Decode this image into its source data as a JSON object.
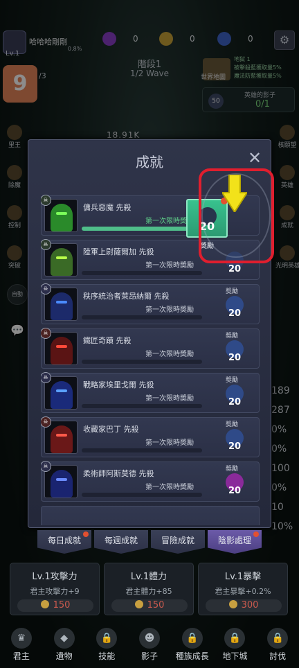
{
  "player": {
    "level": "Lv.1",
    "name": "哈哈哈剛剛",
    "exp": "0.8%"
  },
  "resources": [
    {
      "name": "purple-gem",
      "value": "0",
      "color": "#8a3fc8"
    },
    {
      "name": "gold-coin",
      "value": "0",
      "color": "#c9a238"
    },
    {
      "name": "blue-crystal",
      "value": "0",
      "color": "#3e64c8"
    }
  ],
  "stage": {
    "label": "階段1",
    "wave": "1/2 Wave",
    "wave_count": "/3"
  },
  "badge": "9",
  "world_map": {
    "label": "世界地圖",
    "effects": [
      "地獄 1",
      "被擊殺藍獲取量5%",
      "魔法防藍獲取量5%"
    ]
  },
  "shadow": {
    "title": "英雄的影子",
    "value": "0/1",
    "count": "50"
  },
  "dps": "18.91K",
  "left_side": [
    "里王",
    "除魔",
    "控制",
    "突破"
  ],
  "right_side": [
    "核願望",
    "英雄",
    "成就",
    "光明英雄"
  ],
  "auto_label": "自動",
  "right_stats": [
    "189",
    "287",
    "0%",
    "0%",
    "100",
    "0%",
    "10",
    "10%"
  ],
  "modal": {
    "title": "成就",
    "close": "✕",
    "highlight": {
      "label": "獎勵",
      "value": "20"
    },
    "rows": [
      {
        "name": "傭兵惡魔 先殺",
        "limited": "第一次限時獎勵",
        "reward_label": "",
        "reward": "20",
        "progress": 1.0,
        "fig": "#2a8a2a",
        "eye": "#7cff5a",
        "gem": "#2f3f68"
      },
      {
        "name": "陸軍上尉薩爾加 先殺",
        "limited": "第一次限時獎勵",
        "reward_label": "",
        "reward": "20",
        "progress": 0,
        "fig": "#3a6a26",
        "eye": "#b8ff4a",
        "gem": "#2f3f68"
      },
      {
        "name": "秩序統治者萊昂納爾 先殺",
        "limited": "第一次限時獎勵",
        "reward_label": "獎勵",
        "reward": "20",
        "progress": 0,
        "fig": "#1c2a6a",
        "eye": "#4a8aff",
        "gem": "#2f4a88"
      },
      {
        "name": "鐵匠奇蹟 先殺",
        "limited": "第一次限時獎勵",
        "reward_label": "獎勵",
        "reward": "20",
        "progress": 0,
        "fig": "#5a1414",
        "eye": "#ff4a3a",
        "gem": "#2f4a88"
      },
      {
        "name": "戰略家埃里戈爾 先殺",
        "limited": "第一次限時獎勵",
        "reward_label": "獎勵",
        "reward": "20",
        "progress": 0,
        "fig": "#1a2a7a",
        "eye": "#5aa0ff",
        "gem": "#2f4a88"
      },
      {
        "name": "收藏家巴丁 先殺",
        "limited": "第一次限時獎勵",
        "reward_label": "獎勵",
        "reward": "20",
        "progress": 0,
        "fig": "#6a1818",
        "eye": "#ff5a4a",
        "gem": "#2f4a88"
      },
      {
        "name": "柔術師阿斯莫德 先殺",
        "limited": "第一次限時獎勵",
        "reward_label": "獎勵",
        "reward": "20",
        "progress": 0,
        "fig": "#1a2470",
        "eye": "#6a8aff",
        "gem": "#8a2a9a"
      }
    ]
  },
  "tabs": [
    {
      "label": "每日成就",
      "active": false,
      "dot": true
    },
    {
      "label": "每週成就",
      "active": false,
      "dot": false
    },
    {
      "label": "冒險成就",
      "active": false,
      "dot": false
    },
    {
      "label": "陰影處理",
      "active": true,
      "dot": true
    }
  ],
  "upgrades": [
    {
      "title": "Lv.1攻擊力",
      "desc": "君主攻擊力+9",
      "cost": "150"
    },
    {
      "title": "Lv.1體力",
      "desc": "君主體力+85",
      "cost": "150"
    },
    {
      "title": "Lv.1暴擊",
      "desc": "君主暴擊+0.2%",
      "cost": "300"
    }
  ],
  "nav": [
    {
      "label": "君主",
      "icon": "crown-icon"
    },
    {
      "label": "遺物",
      "icon": "relic-icon"
    },
    {
      "label": "技能",
      "icon": "lock-icon"
    },
    {
      "label": "影子",
      "icon": "shadow-icon"
    },
    {
      "label": "種族成長",
      "icon": "lock-icon"
    },
    {
      "label": "地下城",
      "icon": "lock-icon"
    },
    {
      "label": "討伐",
      "icon": "lock-icon"
    }
  ]
}
